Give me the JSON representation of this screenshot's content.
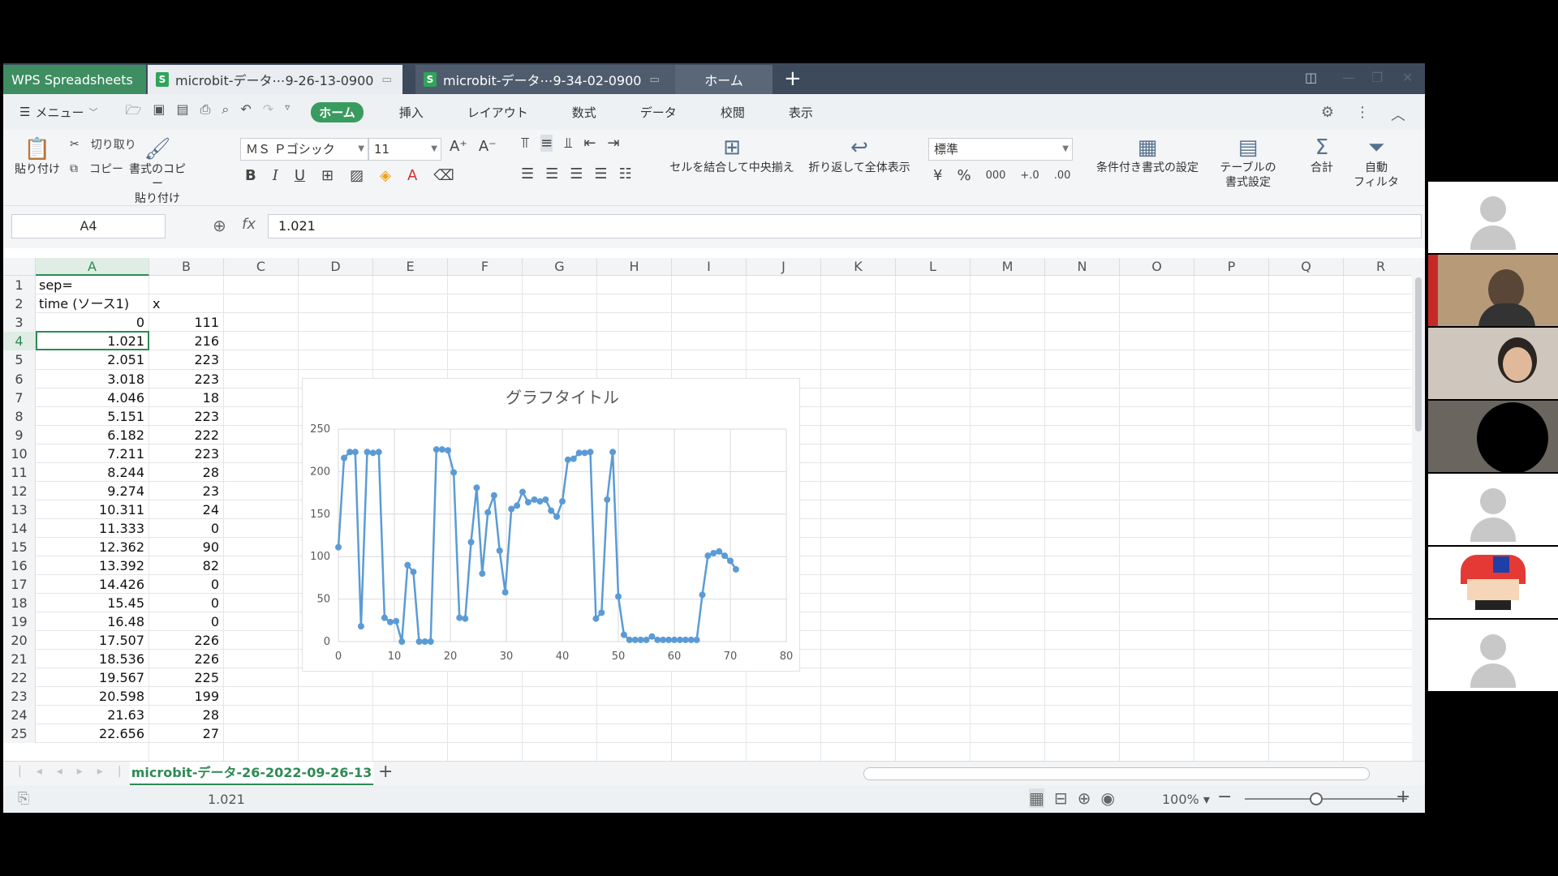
{
  "tabs": {
    "brand": "WPS Spreadsheets",
    "active_doc": "microbit-データ⋯9-26-13-0900",
    "second_doc": "microbit-データ⋯9-34-02-0900",
    "home": "ホーム"
  },
  "menu": {
    "menu_label": "メニュー",
    "ribbon_tabs": [
      "ホーム",
      "挿入",
      "レイアウト",
      "数式",
      "データ",
      "校閲",
      "表示"
    ]
  },
  "ribbon": {
    "paste": "貼り付け",
    "cut": "切り取り",
    "copy": "コピー",
    "format_painter_1": "書式のコピー",
    "format_painter_2": "貼り付け",
    "font_name": "ＭＳ Ｐゴシック",
    "font_size": "11",
    "merge_center": "セルを結合して中央揃え",
    "wrap_text": "折り返して全体表示",
    "number_format": "標準",
    "conditional_format": "条件付き書式の設定",
    "table_format_1": "テーブルの",
    "table_format_2": "書式設定",
    "sum": "合計",
    "filter_1": "自動",
    "filter_2": "フィルタ"
  },
  "formula_bar": {
    "name_box": "A4",
    "fx": "fx",
    "value": "1.021"
  },
  "columns": [
    "A",
    "B",
    "C",
    "D",
    "E",
    "F",
    "G",
    "H",
    "I",
    "J",
    "K",
    "L",
    "M",
    "N",
    "O",
    "P",
    "Q",
    "R"
  ],
  "rows": [
    {
      "n": "1",
      "a": "sep=",
      "b": ""
    },
    {
      "n": "2",
      "a": "time (ソース1)",
      "b": "x"
    },
    {
      "n": "3",
      "a": "0",
      "b": "111"
    },
    {
      "n": "4",
      "a": "1.021",
      "b": "216"
    },
    {
      "n": "5",
      "a": "2.051",
      "b": "223"
    },
    {
      "n": "6",
      "a": "3.018",
      "b": "223"
    },
    {
      "n": "7",
      "a": "4.046",
      "b": "18"
    },
    {
      "n": "8",
      "a": "5.151",
      "b": "223"
    },
    {
      "n": "9",
      "a": "6.182",
      "b": "222"
    },
    {
      "n": "10",
      "a": "7.211",
      "b": "223"
    },
    {
      "n": "11",
      "a": "8.244",
      "b": "28"
    },
    {
      "n": "12",
      "a": "9.274",
      "b": "23"
    },
    {
      "n": "13",
      "a": "10.311",
      "b": "24"
    },
    {
      "n": "14",
      "a": "11.333",
      "b": "0"
    },
    {
      "n": "15",
      "a": "12.362",
      "b": "90"
    },
    {
      "n": "16",
      "a": "13.392",
      "b": "82"
    },
    {
      "n": "17",
      "a": "14.426",
      "b": "0"
    },
    {
      "n": "18",
      "a": "15.45",
      "b": "0"
    },
    {
      "n": "19",
      "a": "16.48",
      "b": "0"
    },
    {
      "n": "20",
      "a": "17.507",
      "b": "226"
    },
    {
      "n": "21",
      "a": "18.536",
      "b": "226"
    },
    {
      "n": "22",
      "a": "19.567",
      "b": "225"
    },
    {
      "n": "23",
      "a": "20.598",
      "b": "199"
    },
    {
      "n": "24",
      "a": "21.63",
      "b": "28"
    },
    {
      "n": "25",
      "a": "22.656",
      "b": "27"
    }
  ],
  "chart_data": {
    "type": "scatter",
    "title": "グラフタイトル",
    "xlim": [
      0,
      80
    ],
    "ylim": [
      0,
      250
    ],
    "x_ticks": [
      "0",
      "10",
      "20",
      "30",
      "40",
      "50",
      "60",
      "70",
      "80"
    ],
    "y_ticks": [
      "0",
      "50",
      "100",
      "150",
      "200",
      "250"
    ],
    "grid": true,
    "color": "#5b9bd5",
    "x": [
      0,
      1.021,
      2.051,
      3.018,
      4.046,
      5.151,
      6.182,
      7.211,
      8.244,
      9.274,
      10.311,
      11.333,
      12.362,
      13.392,
      14.426,
      15.45,
      16.48,
      17.507,
      18.536,
      19.567,
      20.598,
      21.63,
      22.656,
      23.7,
      24.7,
      25.7,
      26.7,
      27.8,
      28.8,
      29.8,
      30.9,
      31.9,
      32.9,
      33.9,
      35,
      36,
      37,
      38,
      39,
      40,
      41,
      42,
      43,
      44,
      45,
      46,
      47,
      48,
      49,
      50,
      51,
      52,
      53,
      54,
      55,
      56,
      57,
      58,
      59,
      60,
      61,
      62,
      63,
      64,
      65,
      66,
      67,
      68,
      69,
      70,
      71
    ],
    "y": [
      111,
      216,
      223,
      223,
      18,
      223,
      222,
      223,
      28,
      23,
      24,
      0,
      90,
      82,
      0,
      0,
      0,
      226,
      226,
      225,
      199,
      28,
      27,
      117,
      181,
      80,
      152,
      172,
      107,
      58,
      156,
      160,
      176,
      164,
      167,
      165,
      167,
      154,
      147,
      165,
      214,
      215,
      222,
      222,
      223,
      27,
      34,
      167,
      223,
      53,
      8,
      2,
      2,
      2,
      2,
      6,
      2,
      2,
      2,
      2,
      2,
      2,
      2,
      2,
      55,
      101,
      104,
      106,
      101,
      95,
      85
    ]
  },
  "sheet": {
    "tab_name": "microbit-データ-26-2022-09-26-13"
  },
  "status": {
    "value": "1.021",
    "zoom": "100%"
  }
}
